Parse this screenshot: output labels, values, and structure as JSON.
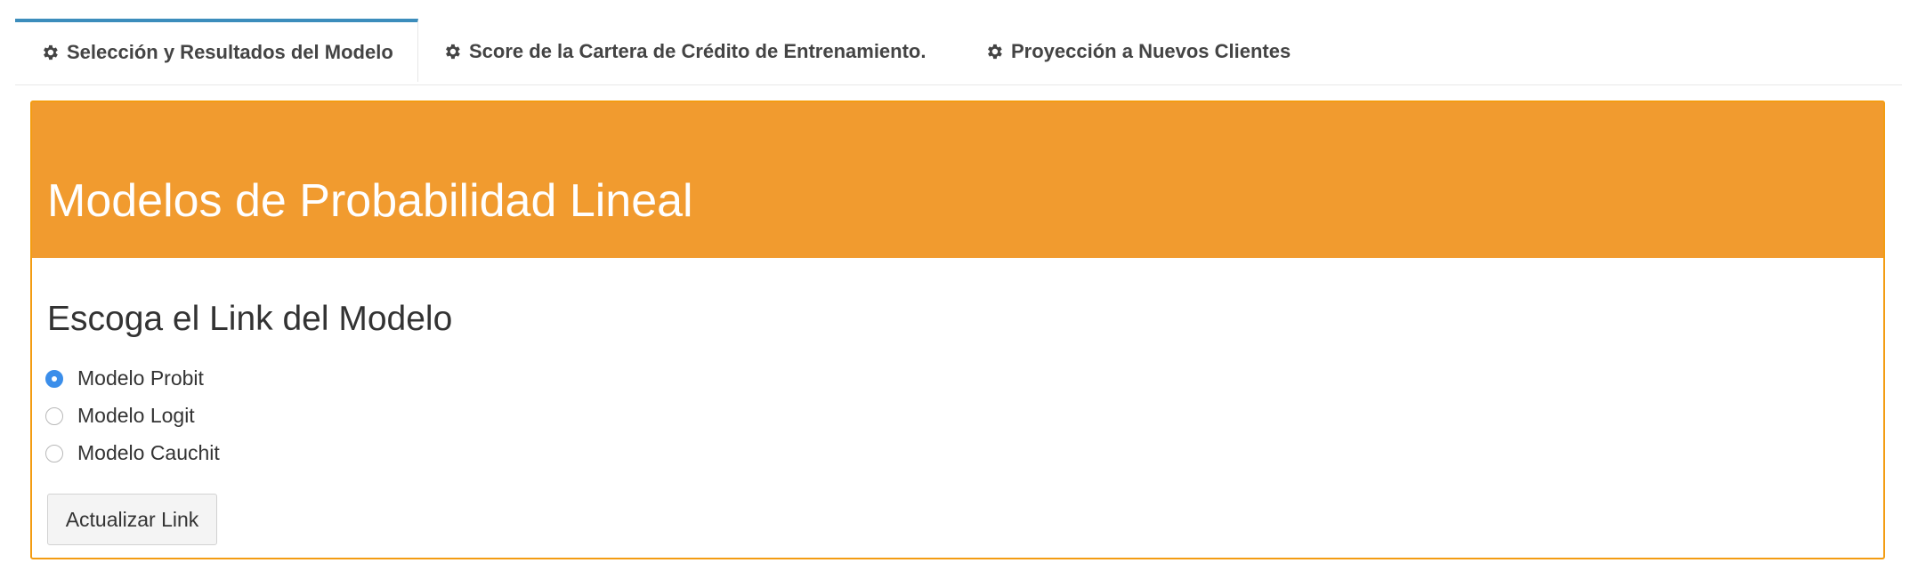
{
  "tabs": [
    {
      "label": "Selección y Resultados del Modelo",
      "icon": "gear-icon",
      "active": true
    },
    {
      "label": "Score de la Cartera de Crédito de Entrenamiento.",
      "icon": "gear-icon",
      "active": false
    },
    {
      "label": "Proyección a Nuevos Clientes",
      "icon": "gear-icon",
      "active": false
    }
  ],
  "panel": {
    "title": "Modelos de Probabilidad Lineal",
    "header_color": "#f19b2f",
    "section_title": "Escoga el Link del Modelo",
    "radio_options": [
      {
        "label": "Modelo Probit",
        "checked": true
      },
      {
        "label": "Modelo Logit",
        "checked": false
      },
      {
        "label": "Modelo Cauchit",
        "checked": false
      }
    ],
    "button_label": "Actualizar Link"
  }
}
